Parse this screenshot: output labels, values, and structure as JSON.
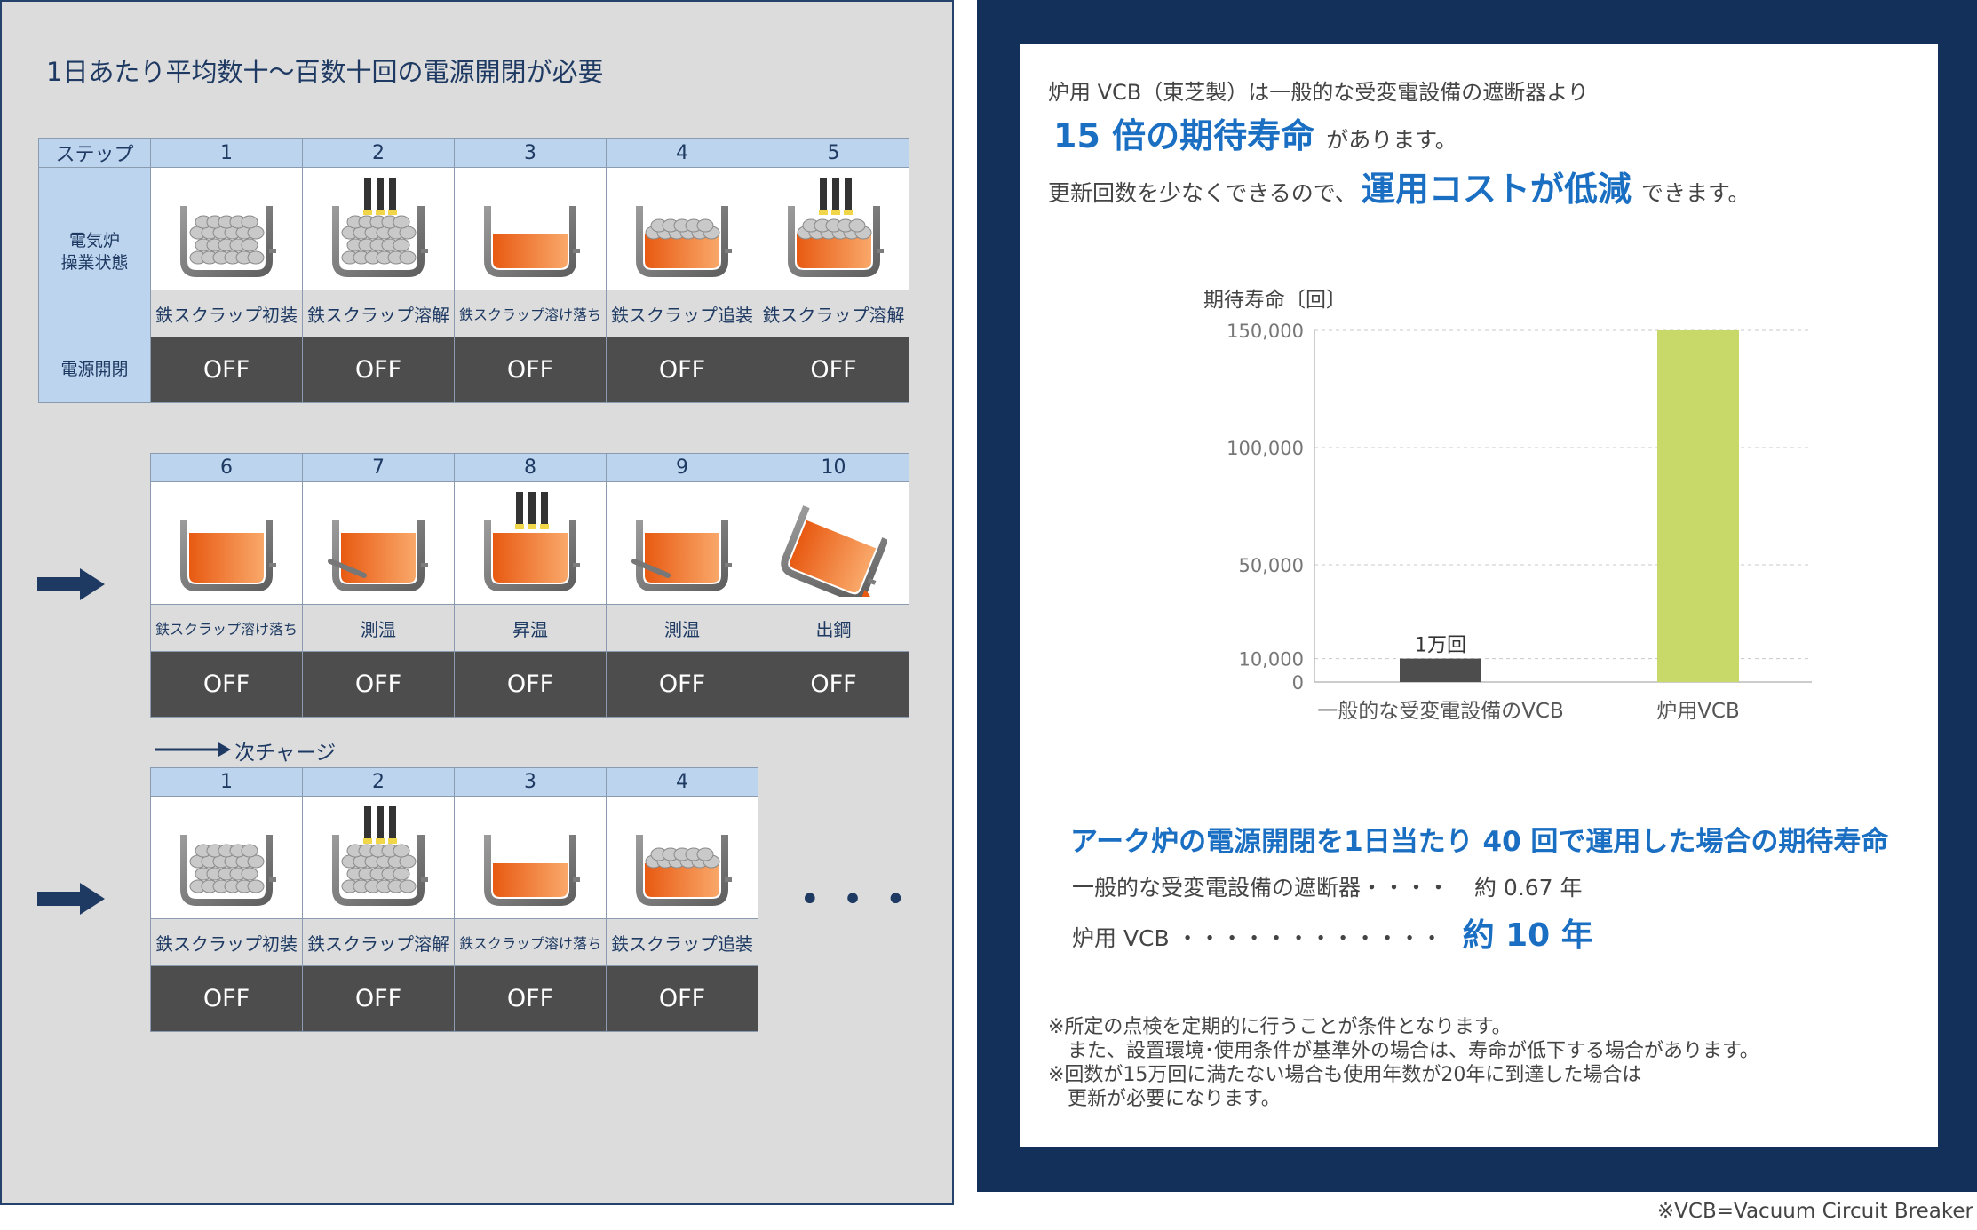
{
  "left": {
    "title": "1日あたり平均数十～百数十回の電源開閉が必要",
    "row_labels": {
      "step": "ステップ",
      "state_line1": "電気炉",
      "state_line2": "操業状態",
      "power": "電源開閉"
    },
    "next_charge": "次チャージ",
    "ellipsis": "• • •",
    "row1": [
      {
        "step": "1",
        "label": "鉄スクラップ初装",
        "power": "OFF",
        "icon": "furnace-scrap-icon"
      },
      {
        "step": "2",
        "label": "鉄スクラップ溶解",
        "power": "OFF",
        "icon": "furnace-electrode-scrap-icon"
      },
      {
        "step": "3",
        "label": "鉄スクラップ溶け落ち",
        "power": "OFF",
        "icon": "furnace-molten-icon"
      },
      {
        "step": "4",
        "label": "鉄スクラップ追装",
        "power": "OFF",
        "icon": "furnace-molten-scrap-icon"
      },
      {
        "step": "5",
        "label": "鉄スクラップ溶解",
        "power": "OFF",
        "icon": "furnace-electrode-molten-scrap-icon"
      }
    ],
    "row2": [
      {
        "step": "6",
        "label": "鉄スクラップ溶け落ち",
        "power": "OFF",
        "icon": "furnace-full-molten-icon"
      },
      {
        "step": "7",
        "label": "測温",
        "power": "OFF",
        "icon": "furnace-probe-icon"
      },
      {
        "step": "8",
        "label": "昇温",
        "power": "OFF",
        "icon": "furnace-electrode-molten-icon"
      },
      {
        "step": "9",
        "label": "測温",
        "power": "OFF",
        "icon": "furnace-probe-icon"
      },
      {
        "step": "10",
        "label": "出鋼",
        "power": "OFF",
        "icon": "furnace-tapping-icon"
      }
    ],
    "row3": [
      {
        "step": "1",
        "label": "鉄スクラップ初装",
        "power": "OFF",
        "icon": "furnace-scrap-icon"
      },
      {
        "step": "2",
        "label": "鉄スクラップ溶解",
        "power": "OFF",
        "icon": "furnace-electrode-scrap-icon"
      },
      {
        "step": "3",
        "label": "鉄スクラップ溶け落ち",
        "power": "OFF",
        "icon": "furnace-molten-icon"
      },
      {
        "step": "4",
        "label": "鉄スクラップ追装",
        "power": "OFF",
        "icon": "furnace-molten-scrap-icon"
      }
    ]
  },
  "right": {
    "intro_line1": "炉用 VCB（東芝製）は一般的な受変電設備の遮断器より",
    "intro_highlight1": "15 倍の期待寿命",
    "intro_line2_suffix": "があります。",
    "intro_line3_prefix": "更新回数を少なくできるので、",
    "intro_highlight2": "運用コストが低減",
    "intro_line3_suffix": "できます。",
    "case_title": "アーク炉の電源開閉を1日当たり 40 回で運用した場合の期待寿命",
    "case_row1_label": "一般的な受変電設備の遮断器・・・・",
    "case_row1_value": "約 0.67 年",
    "case_row2_label": "炉用 VCB ・・・・・・・・・・・・",
    "case_row2_value": "約 10 年",
    "notes": [
      "※所定の点検を定期的に行うことが条件となります。",
      "　また、設置環境･使用条件が基準外の場合は、寿命が低下する場合があります。",
      "※回数が15万回に満たない場合も使用年数が20年に到達した場合は",
      "　更新が必要になります。"
    ]
  },
  "chart_data": {
    "type": "bar",
    "ylabel": "期待寿命〔回〕",
    "categories": [
      "一般的な受変電設備のVCB",
      "炉用VCB"
    ],
    "values": [
      10000,
      150000
    ],
    "data_labels": [
      "1万回",
      ""
    ],
    "yticks": [
      0,
      10000,
      50000,
      100000,
      150000
    ],
    "ytick_labels": [
      "0",
      "10,000",
      "50,000",
      "100,000",
      "150,000"
    ],
    "ylim": [
      0,
      150000
    ],
    "grid": true,
    "colors": [
      "#4d4d4d",
      "#c8d96a"
    ]
  },
  "footnote": "※VCB=Vacuum Circuit Breaker"
}
